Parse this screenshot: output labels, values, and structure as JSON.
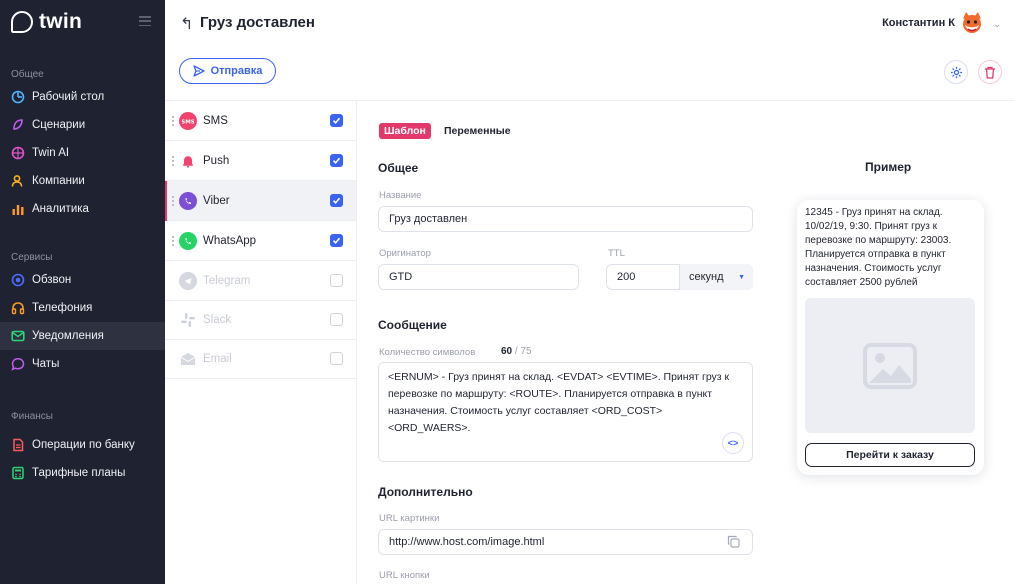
{
  "app": {
    "name": "twin"
  },
  "sidebar": {
    "sections": [
      {
        "label": "Общее"
      },
      {
        "label": "Сервисы"
      },
      {
        "label": "Финансы"
      }
    ],
    "items": [
      {
        "label": "Рабочий стол",
        "icon": "dashboard-icon"
      },
      {
        "label": "Сценарии",
        "icon": "scenarios-icon"
      },
      {
        "label": "Twin AI",
        "icon": "brain-icon"
      },
      {
        "label": "Компании",
        "icon": "users-icon"
      },
      {
        "label": "Аналитика",
        "icon": "chart-icon"
      },
      {
        "label": "Обзвон",
        "icon": "target-icon"
      },
      {
        "label": "Телефония",
        "icon": "headphones-icon"
      },
      {
        "label": "Уведомления",
        "icon": "mail-icon",
        "active": true
      },
      {
        "label": "Чаты",
        "icon": "chat-icon"
      },
      {
        "label": "Операции по банку",
        "icon": "bank-doc-icon"
      },
      {
        "label": "Тарифные планы",
        "icon": "calculator-icon"
      }
    ]
  },
  "header": {
    "title": "Груз доставлен",
    "user_name": "Константин К"
  },
  "toolbar": {
    "send_label": "Отправка"
  },
  "channels": [
    {
      "label": "SMS",
      "checked": true,
      "enabled": true
    },
    {
      "label": "Push",
      "checked": true,
      "enabled": true
    },
    {
      "label": "Viber",
      "checked": true,
      "enabled": true,
      "active": true
    },
    {
      "label": "WhatsApp",
      "checked": true,
      "enabled": true
    },
    {
      "label": "Telegram",
      "checked": false,
      "enabled": false
    },
    {
      "label": "Slack",
      "checked": false,
      "enabled": false
    },
    {
      "label": "Email",
      "checked": false,
      "enabled": false
    }
  ],
  "tabs": {
    "template": "Шаблон",
    "variables": "Переменные"
  },
  "general": {
    "title": "Общее",
    "name_label": "Название",
    "name_value": "Груз доставлен",
    "originator_label": "Оригинатор",
    "originator_value": "GTD",
    "ttl_label": "TTL",
    "ttl_value": "200",
    "ttl_unit": "секунд"
  },
  "message": {
    "title": "Сообщение",
    "count_label": "Количество символов",
    "count_current": "60",
    "count_max": "/ 75",
    "text": "<ERNUM> - Груз принят на склад. <EVDAT> <EVTIME>. Принят груз к перевозке по маршруту: <ROUTE>. Планируется отправка в пункт назначения. Стоимость услуг составляет <ORD_COST> <ORD_WAERS>."
  },
  "additional": {
    "title": "Дополнительно",
    "image_url_label": "URL картинки",
    "image_url_value": "http://www.host.com/image.html",
    "button_url_label": "URL кнопки"
  },
  "preview": {
    "title": "Пример",
    "text": "12345 - Груз принят на склад. 10/02/19, 9:30. Принят груз к перевозке по маршруту: 23003. Планируется отправка в пункт назначения. Стоимость услуг составляет 2500 рублей",
    "button_label": "Перейти к заказу"
  },
  "colors": {
    "accent": "#3a63f0",
    "brand_pink": "#e2386a",
    "sidebar_bg": "#1f2230"
  }
}
